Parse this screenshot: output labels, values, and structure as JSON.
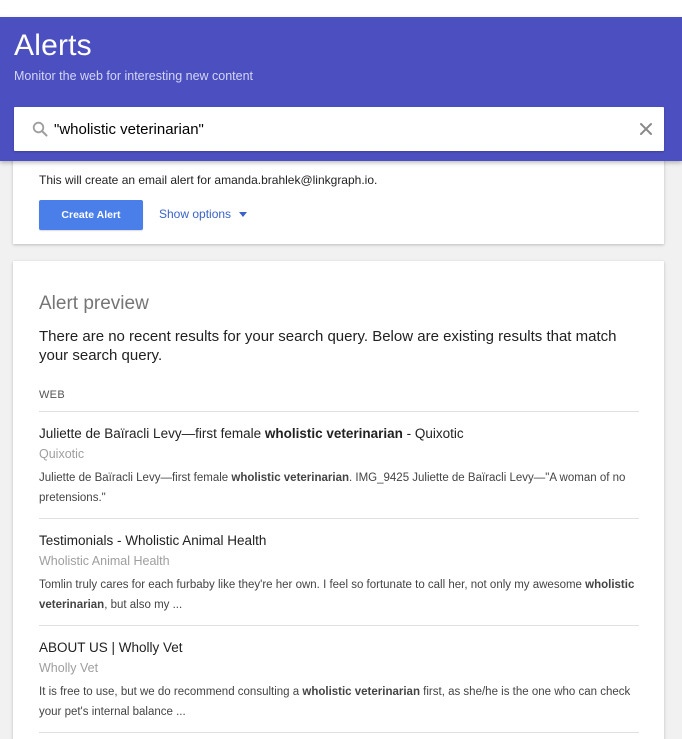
{
  "header": {
    "title": "Alerts",
    "subtitle": "Monitor the web for interesting new content"
  },
  "search": {
    "value": "\"wholistic veterinarian\"",
    "icon": "search-icon",
    "clear_icon": "close-icon"
  },
  "create_panel": {
    "email_note": "This will create an email alert for amanda.brahlek@linkgraph.io.",
    "create_button": "Create Alert",
    "show_options": "Show options"
  },
  "preview": {
    "title": "Alert preview",
    "message": "There are no recent results for your search query. Below are existing results that match your search query.",
    "section_label": "WEB",
    "results": [
      {
        "title_pre": "Juliette de Baïracli Levy—first female ",
        "title_bold": "wholistic veterinarian",
        "title_post": " - Quixotic",
        "source": "Quixotic",
        "snippet_pre": "Juliette de Baïracli Levy—first female ",
        "snippet_bold": "wholistic veterinarian",
        "snippet_post": ". IMG_9425 Juliette de Baïracli Levy—\"A woman of no pretensions.\""
      },
      {
        "title_pre": "Testimonials - Wholistic Animal Health",
        "title_bold": "",
        "title_post": "",
        "source": "Wholistic Animal Health",
        "snippet_pre": "Tomlin truly cares for each furbaby like they're her own. I feel so fortunate to call her, not only my awesome ",
        "snippet_bold": "wholistic veterinarian",
        "snippet_post": ", but also my ..."
      },
      {
        "title_pre": "ABOUT US | Wholly Vet",
        "title_bold": "",
        "title_post": "",
        "source": "Wholly Vet",
        "snippet_pre": "It is free to use, but we do recommend consulting a ",
        "snippet_bold": "wholistic veterinarian",
        "snippet_post": " first, as she/he is the one who can check your pet's internal balance ..."
      }
    ]
  },
  "colors": {
    "header_bg": "#4c4fbf",
    "button_bg": "#4a7ee8",
    "link": "#3b62c7"
  }
}
